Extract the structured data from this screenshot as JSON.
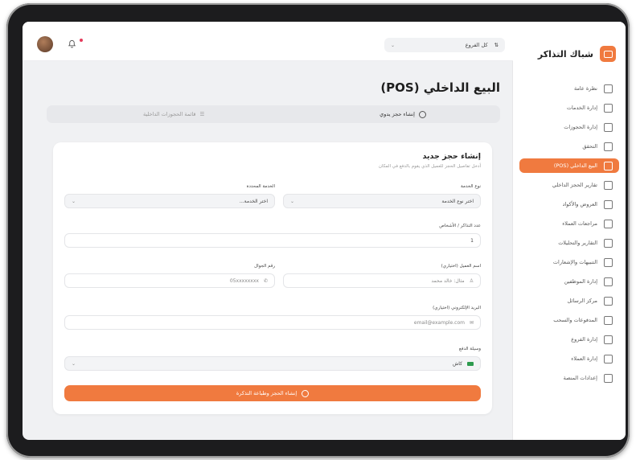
{
  "brand": {
    "name": "شباك التذاكر"
  },
  "sidebar": {
    "items": [
      {
        "label": "نظرة عامة",
        "icon": "grid-icon",
        "active": false
      },
      {
        "label": "إدارة الخدمات",
        "icon": "briefcase-icon",
        "active": false
      },
      {
        "label": "إدارة الحجوزات",
        "icon": "calendar-icon",
        "active": false
      },
      {
        "label": "التحقق",
        "icon": "qr-icon",
        "active": false
      },
      {
        "label": "البيع الداخلي (POS)",
        "icon": "pos-icon",
        "active": true
      },
      {
        "label": "تقارير الحجز الداخلي",
        "icon": "report-icon",
        "active": false
      },
      {
        "label": "العروض والأكواد",
        "icon": "tag-icon",
        "active": false
      },
      {
        "label": "مراجعات العملاء",
        "icon": "star-icon",
        "active": false
      },
      {
        "label": "التقارير والتحليلات",
        "icon": "chart-icon",
        "active": false
      },
      {
        "label": "التنبيهات والإشعارات",
        "icon": "settings-icon",
        "active": false
      },
      {
        "label": "إدارة الموظفين",
        "icon": "users-icon",
        "active": false
      },
      {
        "label": "مركز الرسائل",
        "icon": "message-icon",
        "active": false
      },
      {
        "label": "المدفوعات والسحب",
        "icon": "wallet-icon",
        "active": false
      },
      {
        "label": "إدارة الفروع",
        "icon": "branch-icon",
        "active": false
      },
      {
        "label": "إدارة العملاء",
        "icon": "customers-icon",
        "active": false
      },
      {
        "label": "إعدادات المنصة",
        "icon": "gear-icon",
        "active": false
      }
    ]
  },
  "topbar": {
    "branch_label": "كل الفروع"
  },
  "page": {
    "title": "البيع الداخلي (POS)"
  },
  "tabs": [
    {
      "label": "إنشاء حجز يدوي",
      "active": true
    },
    {
      "label": "قائمة الحجوزات الداخلية",
      "active": false
    }
  ],
  "form": {
    "title": "إنشاء حجز جديد",
    "subtitle": "أدخل تفاصيل الحجز للعميل الذي يقوم بالدفع في المكان",
    "service_type": {
      "label": "نوع الخدمة",
      "value": "اختر نوع الخدمة"
    },
    "service": {
      "label": "الخدمة المحددة",
      "value": "اختر الخدمة..."
    },
    "people_count": {
      "label": "عدد التذاكر / الأشخاص",
      "value": "1"
    },
    "customer_name": {
      "label": "اسم العميل (اختياري)",
      "placeholder": "مثال: خالد محمد"
    },
    "phone": {
      "label": "رقم الجوال",
      "placeholder": "05xxxxxxxx"
    },
    "email": {
      "label": "البريد الإلكتروني (اختياري)",
      "placeholder": "email@example.com"
    },
    "payment": {
      "label": "وسيلة الدفع",
      "value": "كاش"
    },
    "submit_label": "إنشاء الحجز وطباعة التذكرة"
  }
}
